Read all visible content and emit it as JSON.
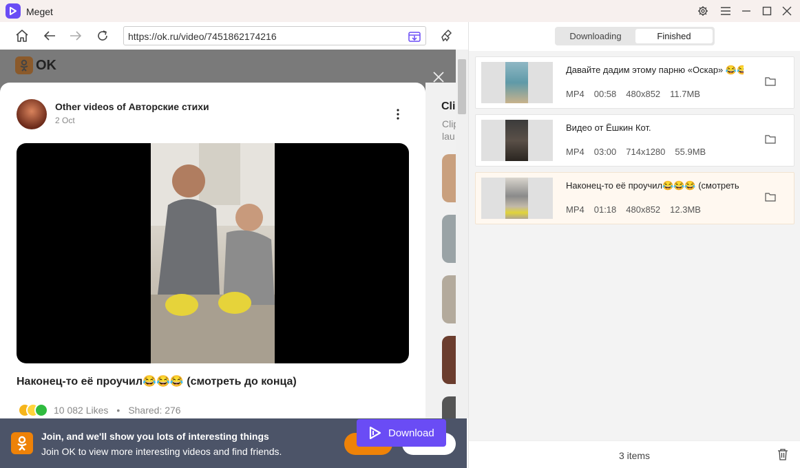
{
  "app": {
    "title": "Meget",
    "brand_color": "#6a4cf5"
  },
  "window_controls": [
    "gear-icon",
    "menu-icon",
    "minimize-icon",
    "maximize-icon",
    "close-icon"
  ],
  "browser": {
    "url": "https://ok.ru/video/7451862174216",
    "site_logo_text": "OK",
    "post": {
      "channel": "Other videos of Авторские стихи",
      "date": "2 Oct",
      "video_title": "Наконец-то её проучил😂😂😂 (смотреть до конца)",
      "likes": "10 082 Likes",
      "separator": "•",
      "shared": "Shared: 276"
    },
    "right_strip": {
      "heading": "Cli",
      "sub1": "Clip",
      "sub2": "lau"
    },
    "banner": {
      "heading": "Join, and we'll show you lots of interesting things",
      "subtext": "Join OK to view more interesting videos and find friends."
    },
    "download_button": "Download"
  },
  "panel": {
    "tabs": [
      {
        "label": "Downloading",
        "active": false
      },
      {
        "label": "Finished",
        "active": true
      }
    ],
    "items": [
      {
        "title": "Давайте дадим этому парню «Оскар» 😂😂",
        "format": "MP4",
        "duration": "00:58",
        "resolution": "480x852",
        "size": "11.7MB"
      },
      {
        "title": "Видео от Ёшкин Кот.",
        "format": "MP4",
        "duration": "03:00",
        "resolution": "714x1280",
        "size": "55.9MB"
      },
      {
        "title": "Наконец-то её проучил😂😂😂 (смотреть",
        "format": "MP4",
        "duration": "01:18",
        "resolution": "480x852",
        "size": "12.3MB"
      }
    ],
    "footer_count": "3 items"
  }
}
